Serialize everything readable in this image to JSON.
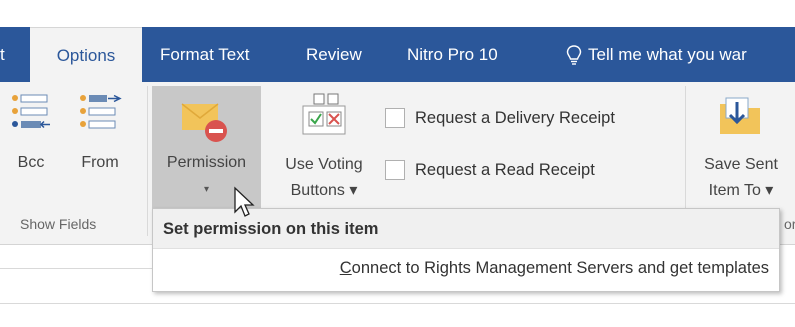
{
  "tabs": {
    "prev_partial": "t",
    "options": "Options",
    "format_text": "Format Text",
    "review": "Review",
    "nitro": "Nitro Pro 10",
    "tell_me": "Tell me what you war"
  },
  "ribbon": {
    "bcc": "Bcc",
    "from": "From",
    "permission": "Permission",
    "permission_arrow": "▾",
    "voting_line1": "Use Voting",
    "voting_line2": "Buttons ▾",
    "delivery_receipt": "Request a Delivery Receipt",
    "read_receipt": "Request a Read Receipt",
    "save_sent_line1": "Save Sent",
    "save_sent_line2": "Item To ▾",
    "show_fields_group": "Show Fields",
    "edge_group_fragment": "or"
  },
  "tooltip": {
    "title": "Set permission on this item",
    "link_first": "C",
    "link_rest": "onnect to Rights Management Servers and get templates"
  },
  "colors": {
    "accent": "#2b579a",
    "ribbon_bg": "#f3f3f3",
    "pressed_bg": "#c8c8c8"
  }
}
